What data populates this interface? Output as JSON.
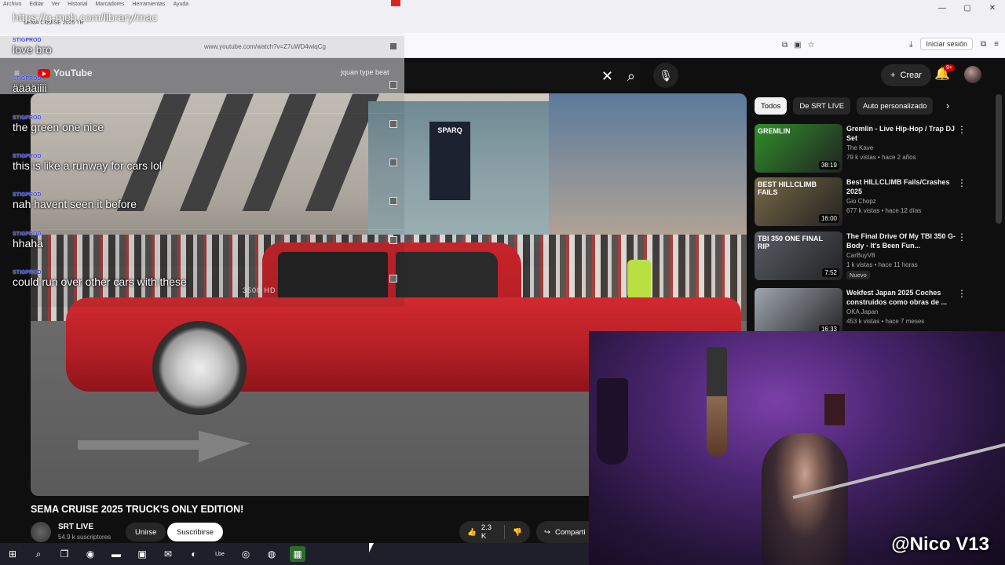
{
  "browser": {
    "window_controls": [
      "—",
      "▢",
      "✕"
    ],
    "address_icons": [
      "⧉",
      "▣",
      "☆"
    ],
    "signin_label": "Iniciar sesión"
  },
  "youtube": {
    "logo_text": "YouTube",
    "create_label": "Crear",
    "notification_count": "9+"
  },
  "video": {
    "title": "SEMA CRUISE 2025 TRUCK'S ONLY EDITION!",
    "badge_text": "3500 HD",
    "sign_text": "SPARQ",
    "channel_name": "SRT LIVE",
    "channel_subs": "54.9 k suscriptores",
    "join_label": "Unirse",
    "subscribe_label": "Suscribirse",
    "like_count": "2.3 K",
    "share_label": "Comparti"
  },
  "sidebar": {
    "chips": [
      {
        "label": "Todos",
        "active": true
      },
      {
        "label": "De SRT LIVE",
        "active": false
      },
      {
        "label": "Auto personalizado",
        "active": false
      }
    ],
    "recommendations": [
      {
        "title": "Gremlin - Live Hip-Hop / Trap DJ Set",
        "channel": "The Kave",
        "meta": "79 k vistas • hace 2 años",
        "duration": "38:19",
        "thumb_color": "#2f8f2a",
        "thumb_text": "GREMLIN",
        "is_new": false
      },
      {
        "title": "Best HILLCLIMB Fails/Crashes 2025",
        "channel": "Gio Chopz",
        "meta": "677 k vistas • hace 12 días",
        "duration": "16:00",
        "thumb_color": "#7a6a48",
        "thumb_text": "BEST HILLCLIMB FAILS",
        "is_new": false
      },
      {
        "title": "The Final Drive Of My TBI 350 G-Body - It's Been Fun...",
        "channel": "CarBuyV8",
        "meta": "1 k vistas • hace 11 horas",
        "duration": "7:52",
        "thumb_color": "#5a5e66",
        "thumb_text": "TBI 350 ONE FINAL RIP",
        "is_new": true,
        "new_label": "Nuevo"
      },
      {
        "title": "Wekfest Japan 2025 Coches construidos como obras de ...",
        "channel": "OKA Japan",
        "meta": "453 k vistas • hace 7 meses",
        "duration": "16:33",
        "thumb_color": "#a0a6b0",
        "thumb_text": "",
        "is_new": false
      }
    ]
  },
  "webcam": {
    "tag": "@Nico V13"
  },
  "overlay": {
    "menu": [
      "Archivo",
      "Editar",
      "Ver",
      "Historial",
      "Marcadores",
      "Herramientas",
      "Ayuda"
    ],
    "url": "https://g-meh.com/library/mac",
    "address_hint": "www.youtube.com/watch?v=Z7uWD4wiqCg",
    "tab_hint": "SEMA CRUISE 2025 TR",
    "search_text": "jquan type beat",
    "messages": [
      {
        "user": "STIGPROD",
        "text": "love bro"
      },
      {
        "user": "STIGPROD",
        "text": "ääääiiii"
      },
      {
        "user": "STIGPROD",
        "text": "the green one nice"
      },
      {
        "user": "STIGPROD",
        "text": "this is like a runway for cars lol"
      },
      {
        "user": "STIGPROD",
        "text": "nah havent seen it before"
      },
      {
        "user": "STIGPROD",
        "text": "hhaha"
      },
      {
        "user": "STIGPROD",
        "text": "could run over other cars with these"
      }
    ]
  },
  "taskbar": {
    "items": [
      {
        "icon": "windows-icon",
        "glyph": "⊞",
        "active": false
      },
      {
        "icon": "search-icon",
        "glyph": "⌕",
        "active": false
      },
      {
        "icon": "task-view-icon",
        "glyph": "❐",
        "active": false
      },
      {
        "icon": "edge-icon",
        "glyph": "◉",
        "active": false
      },
      {
        "icon": "folder-icon",
        "glyph": "▬",
        "active": false
      },
      {
        "icon": "store-icon",
        "glyph": "▣",
        "active": false
      },
      {
        "icon": "mail-icon",
        "glyph": "✉",
        "active": false
      },
      {
        "icon": "firefox-icon",
        "glyph": "◐",
        "active": false
      },
      {
        "icon": "app-icon",
        "glyph": "Lbe",
        "active": false
      },
      {
        "icon": "chrome-icon",
        "glyph": "◎",
        "active": false
      },
      {
        "icon": "obs-icon",
        "glyph": "◍",
        "active": false
      },
      {
        "icon": "grid-app-icon",
        "glyph": "▦",
        "active": true
      }
    ]
  }
}
